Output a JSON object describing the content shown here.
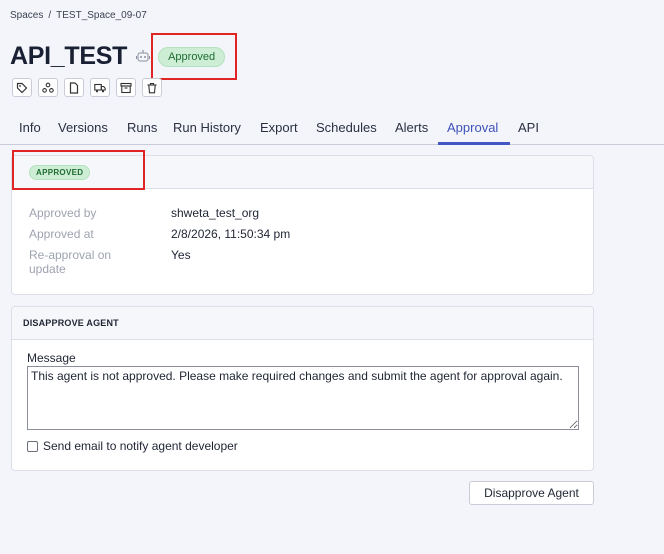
{
  "breadcrumb": {
    "root": "Spaces",
    "separator": "/",
    "current": "TEST_Space_09-07"
  },
  "page": {
    "title": "API_TEST",
    "status": "Approved"
  },
  "toolbar_icons": [
    "tag-icon",
    "agents-icon",
    "document-icon",
    "deploy-truck-icon",
    "archive-icon",
    "trash-icon"
  ],
  "tabs": [
    "Info",
    "Versions",
    "Runs",
    "Run History",
    "Export",
    "Schedules",
    "Alerts",
    "Approval",
    "API"
  ],
  "active_tab": "Approval",
  "approval": {
    "badge": "APPROVED",
    "rows": [
      {
        "label": "Approved by",
        "value": "shweta_test_org"
      },
      {
        "label": "Approved at",
        "value": "2/8/2026, 11:50:34 pm"
      },
      {
        "label": "Re-approval on update",
        "value": "Yes"
      }
    ]
  },
  "disapprove": {
    "section_title": "DISAPPROVE AGENT",
    "message_label": "Message",
    "message_value": "This agent is not approved. Please make required changes and submit the agent for approval again.",
    "notify_label": "Send email to notify agent developer",
    "notify_checked": false,
    "button_label": "Disapprove Agent"
  },
  "colors": {
    "accent": "#4256c4",
    "success_bg": "#cdeed4",
    "success_text": "#1f6b33",
    "highlight": "#e02424"
  }
}
